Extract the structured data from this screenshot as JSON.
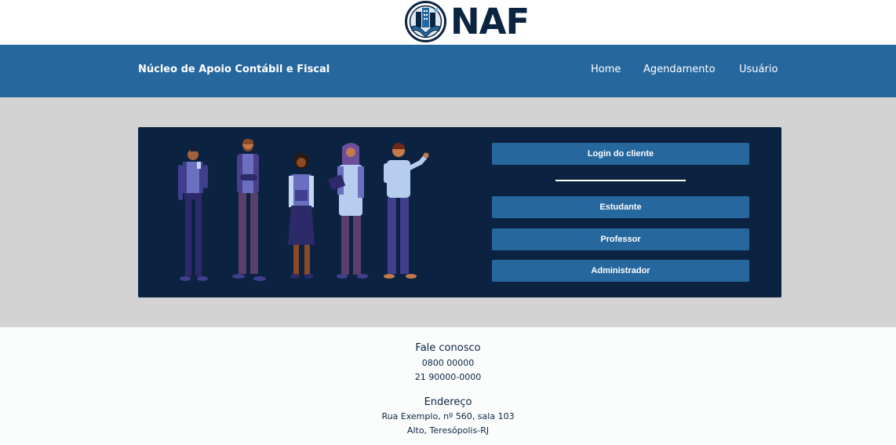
{
  "logo": {
    "text": "NAF",
    "icon": "building-hands-emblem"
  },
  "navbar": {
    "brand": "Núcleo de Apoio Contábil e Fiscal",
    "links": [
      "Home",
      "Agendamento",
      "Usuário"
    ]
  },
  "login_card": {
    "illustration": "group-of-people-illustration",
    "client_button": "Login do cliente",
    "role_buttons": [
      "Estudante",
      "Professor",
      "Administrador"
    ]
  },
  "footer": {
    "contact_heading": "Fale conosco",
    "phones": [
      "0800 00000",
      "21 90000-0000"
    ],
    "address_heading": "Endereço",
    "address_lines": [
      "Rua Exemplo, nº 560, sala 103",
      "Alto, Teresópolis-RJ"
    ]
  },
  "colors": {
    "navbar": "#26679e",
    "card": "#0b2340",
    "main_bg": "#d3d3d3",
    "button": "#26679e"
  }
}
